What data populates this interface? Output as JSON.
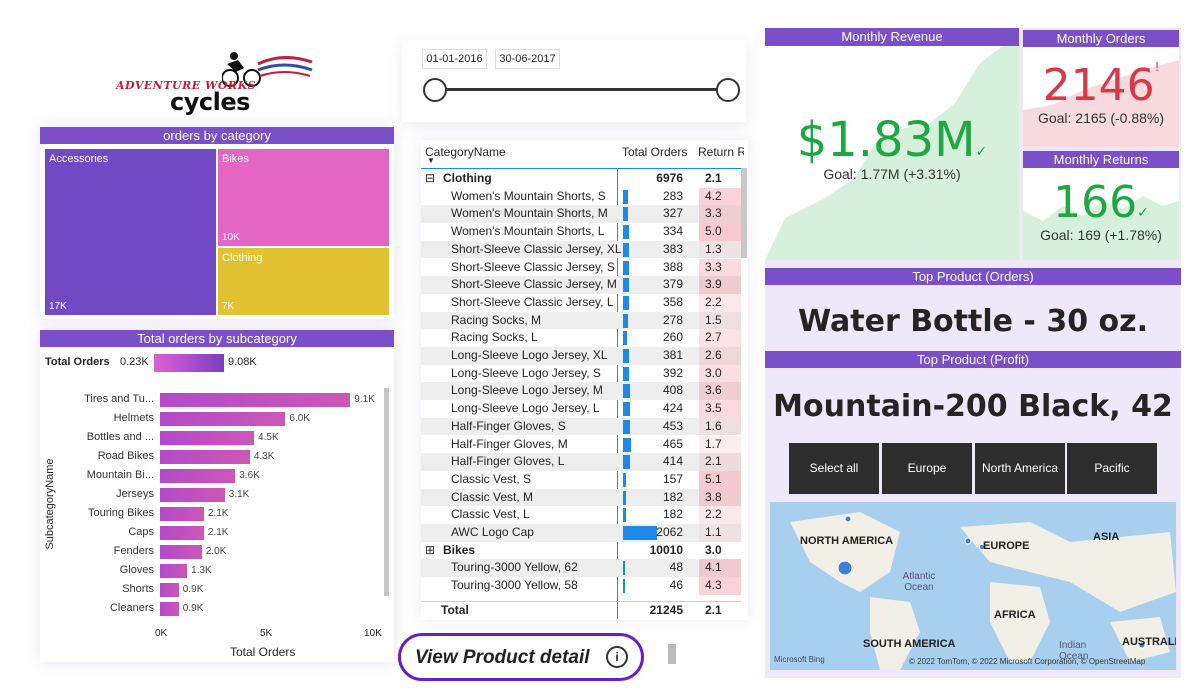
{
  "logo": {
    "top": "ADVENTURE WORKS",
    "bottom": "cycles"
  },
  "date_slicer": {
    "start": "01-01-2016",
    "end": "30-06-2017"
  },
  "treemap": {
    "title": "orders by category",
    "items": [
      {
        "name": "Accessories",
        "value": "17K",
        "color": "#7249c4"
      },
      {
        "name": "Bikes",
        "value": "10K",
        "color": "#e465c4"
      },
      {
        "name": "Clothing",
        "value": "7K",
        "color": "#e2c230"
      }
    ]
  },
  "subcat": {
    "title": "Total orders by subcategory",
    "legend_label": "Total Orders",
    "legend_min": "0.23K",
    "legend_max": "9.08K",
    "ylabel": "SubcategoryName",
    "xlabel": "Total Orders",
    "ticks": [
      "0K",
      "5K",
      "10K"
    ]
  },
  "chart_data": {
    "type": "bar",
    "title": "Total orders by subcategory",
    "xlabel": "Total Orders",
    "ylabel": "SubcategoryName",
    "xlim": [
      0,
      10000
    ],
    "categories": [
      "Tires and Tu...",
      "Helmets",
      "Bottles and ...",
      "Road Bikes",
      "Mountain Bi...",
      "Jerseys",
      "Touring Bikes",
      "Caps",
      "Fenders",
      "Gloves",
      "Shorts",
      "Cleaners"
    ],
    "values": [
      9100,
      6000,
      4500,
      4300,
      3600,
      3100,
      2100,
      2100,
      2000,
      1300,
      900,
      900
    ],
    "labels": [
      "9.1K",
      "6.0K",
      "4.5K",
      "4.3K",
      "3.6K",
      "3.1K",
      "2.1K",
      "2.1K",
      "2.0K",
      "1.3K",
      "0.9K",
      "0.9K"
    ]
  },
  "table": {
    "headers": [
      "CategoryName",
      "Total Orders",
      "Return R"
    ],
    "rows": [
      {
        "type": "group",
        "name": "Clothing",
        "orders": "6976",
        "ret": "2.1",
        "sign": "⊟"
      },
      {
        "type": "item",
        "name": "Women's Mountain Shorts, S",
        "orders": "283",
        "ret": "4.2",
        "pct": 0.137
      },
      {
        "type": "item",
        "name": "Women's Mountain Shorts, M",
        "orders": "327",
        "ret": "3.3",
        "pct": 0.159
      },
      {
        "type": "item",
        "name": "Women's Mountain Shorts, L",
        "orders": "334",
        "ret": "5.0",
        "pct": 0.162
      },
      {
        "type": "item",
        "name": "Short-Sleeve Classic Jersey, XL",
        "orders": "383",
        "ret": "1.3",
        "pct": 0.186
      },
      {
        "type": "item",
        "name": "Short-Sleeve Classic Jersey, S",
        "orders": "388",
        "ret": "3.3",
        "pct": 0.188
      },
      {
        "type": "item",
        "name": "Short-Sleeve Classic Jersey, M",
        "orders": "379",
        "ret": "3.9",
        "pct": 0.184
      },
      {
        "type": "item",
        "name": "Short-Sleeve Classic Jersey, L",
        "orders": "358",
        "ret": "2.2",
        "pct": 0.174
      },
      {
        "type": "item",
        "name": "Racing Socks, M",
        "orders": "278",
        "ret": "1.5",
        "pct": 0.135
      },
      {
        "type": "item",
        "name": "Racing Socks, L",
        "orders": "260",
        "ret": "2.7",
        "pct": 0.126
      },
      {
        "type": "item",
        "name": "Long-Sleeve Logo Jersey, XL",
        "orders": "381",
        "ret": "2.6",
        "pct": 0.185
      },
      {
        "type": "item",
        "name": "Long-Sleeve Logo Jersey, S",
        "orders": "392",
        "ret": "3.0",
        "pct": 0.19
      },
      {
        "type": "item",
        "name": "Long-Sleeve Logo Jersey, M",
        "orders": "408",
        "ret": "3.6",
        "pct": 0.198
      },
      {
        "type": "item",
        "name": "Long-Sleeve Logo Jersey, L",
        "orders": "424",
        "ret": "3.5",
        "pct": 0.206
      },
      {
        "type": "item",
        "name": "Half-Finger Gloves, S",
        "orders": "453",
        "ret": "1.6",
        "pct": 0.22
      },
      {
        "type": "item",
        "name": "Half-Finger Gloves, M",
        "orders": "465",
        "ret": "1.7",
        "pct": 0.225
      },
      {
        "type": "item",
        "name": "Half-Finger Gloves, L",
        "orders": "414",
        "ret": "2.1",
        "pct": 0.201
      },
      {
        "type": "item",
        "name": "Classic Vest, S",
        "orders": "157",
        "ret": "5.1",
        "pct": 0.076
      },
      {
        "type": "item",
        "name": "Classic Vest, M",
        "orders": "182",
        "ret": "3.8",
        "pct": 0.088
      },
      {
        "type": "item",
        "name": "Classic Vest, L",
        "orders": "182",
        "ret": "2.2",
        "pct": 0.088
      },
      {
        "type": "item",
        "name": "AWC Logo Cap",
        "orders": "2062",
        "ret": "1.1",
        "pct": 1.0
      },
      {
        "type": "group",
        "name": "Bikes",
        "orders": "10010",
        "ret": "3.0",
        "sign": "⊞"
      },
      {
        "type": "item",
        "name": "Touring-3000 Yellow, 62",
        "orders": "48",
        "ret": "4.1",
        "pct": 0.023
      },
      {
        "type": "item",
        "name": "Touring-3000 Yellow, 58",
        "orders": "46",
        "ret": "4.3",
        "pct": 0.022
      }
    ],
    "total": {
      "name": "Total",
      "orders": "21245",
      "ret": "2.1"
    }
  },
  "product_link": "View Product detail",
  "kpi": {
    "revenue": {
      "title": "Monthly Revenue",
      "value": "$1.83M",
      "goal": "Goal: 1.77M (+3.31%)",
      "color": "#1ea743"
    },
    "orders": {
      "title": "Monthly Orders",
      "value": "2146",
      "goal": "Goal: 2165 (-0.88%)",
      "color": "#d63a48"
    },
    "returns": {
      "title": "Monthly Returns",
      "value": "166",
      "goal": "Goal: 169 (+1.78%)",
      "color": "#1ea743"
    }
  },
  "top_orders": {
    "title": "Top Product (Orders)",
    "value": "Water Bottle - 30 oz."
  },
  "top_profit": {
    "title": "Top Product (Profit)",
    "value": "Mountain-200 Black, 42"
  },
  "region_buttons": [
    "Select all",
    "Europe",
    "North America",
    "Pacific"
  ],
  "map": {
    "labels": [
      "NORTH AMERICA",
      "EUROPE",
      "ASIA",
      "Atlantic Ocean",
      "AFRICA",
      "SOUTH AMERICA",
      "Indian Ocean",
      "AUSTRALIA"
    ],
    "brand": "Microsoft Bing",
    "copyright": "© 2022 TomTom, © 2022 Microsoft Corporation, © OpenStreetMap"
  }
}
